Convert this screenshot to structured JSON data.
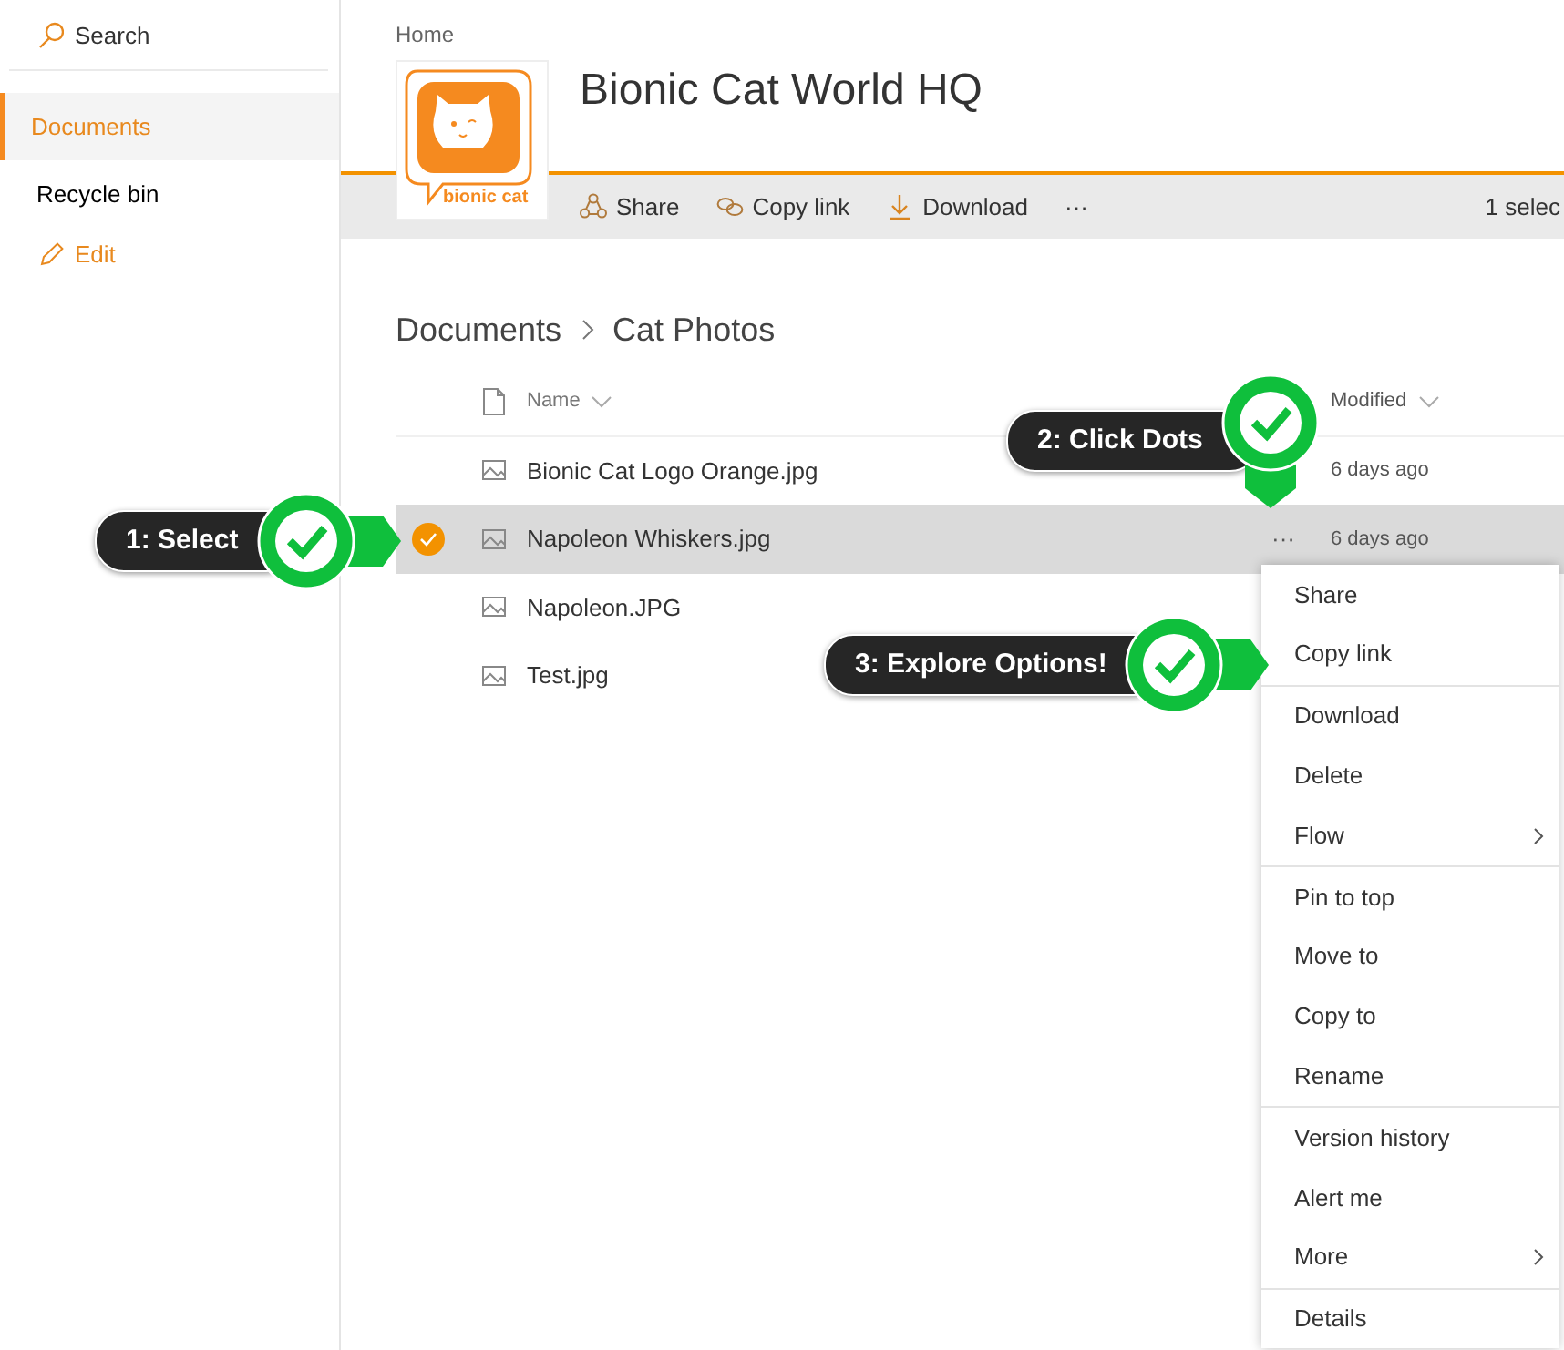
{
  "sidebar": {
    "search": {
      "label": "Search"
    },
    "items": [
      {
        "label": "Documents",
        "selected": true
      },
      {
        "label": "Recycle bin",
        "selected": false
      }
    ],
    "edit": "Edit"
  },
  "header": {
    "breadcrumb": "Home",
    "site_title": "Bionic Cat World HQ",
    "logo_text": "bionic cat"
  },
  "toolbar": {
    "actions": [
      {
        "label": "Share"
      },
      {
        "label": "Copy link"
      },
      {
        "label": "Download"
      },
      {
        "label": "···"
      }
    ],
    "selection_status": "1 selec"
  },
  "path": [
    "Documents",
    "Cat Photos"
  ],
  "table": {
    "columns": [
      {
        "label": "Name"
      },
      {
        "label": "Modified"
      }
    ],
    "rows": [
      {
        "name": "Bionic Cat Logo Orange.jpg",
        "modified": "6 days ago",
        "selected": false
      },
      {
        "name": "Napoleon Whiskers.jpg",
        "modified": "6 days ago",
        "selected": true,
        "actions": "···"
      },
      {
        "name": "Napoleon.JPG",
        "selected": false
      },
      {
        "name": "Test.jpg",
        "selected": false
      }
    ]
  },
  "context_menu": {
    "groups": [
      [
        {
          "label": "Share"
        },
        {
          "label": "Copy link"
        }
      ],
      [
        {
          "label": "Download"
        },
        {
          "label": "Delete"
        },
        {
          "label": "Flow",
          "submenu": true
        }
      ],
      [
        {
          "label": "Pin to top"
        },
        {
          "label": "Move to"
        },
        {
          "label": "Copy to"
        },
        {
          "label": "Rename"
        }
      ],
      [
        {
          "label": "Version history"
        },
        {
          "label": "Alert me"
        },
        {
          "label": "More",
          "submenu": true
        }
      ],
      [
        {
          "label": "Details"
        }
      ]
    ]
  },
  "callouts": [
    {
      "label": "1: Select"
    },
    {
      "label": "2: Click Dots"
    },
    {
      "label": "3: Explore Options!"
    }
  ]
}
